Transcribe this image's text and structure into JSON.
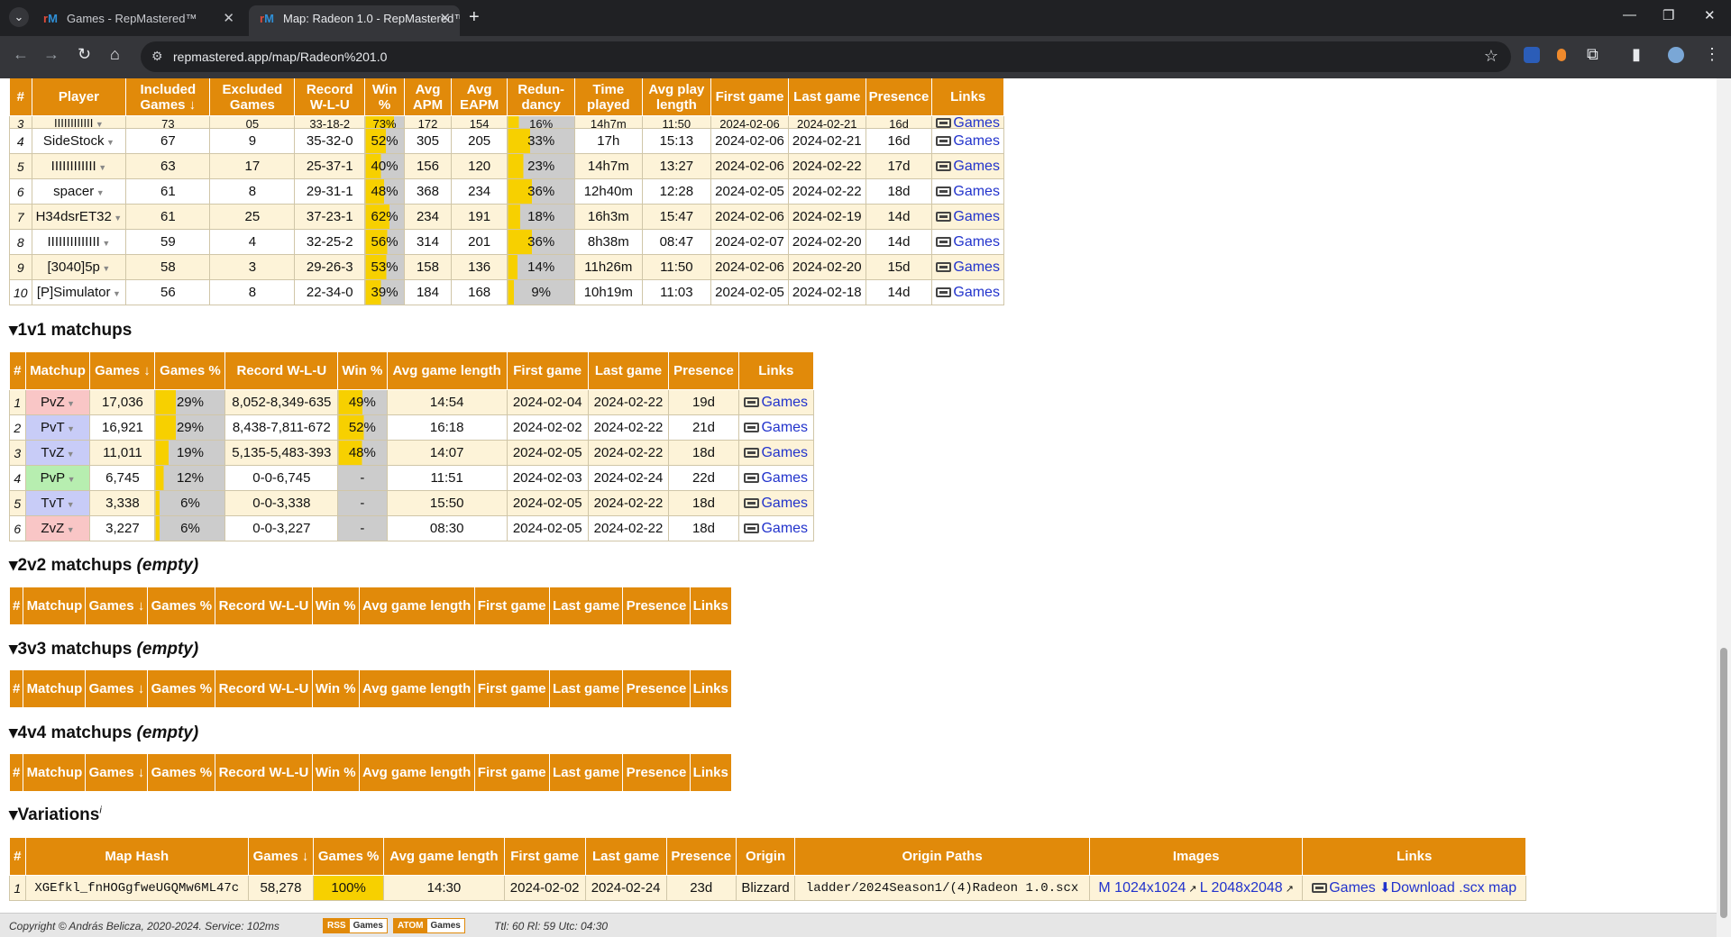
{
  "browser": {
    "tabs": [
      {
        "label": "Games - RepMastered™"
      },
      {
        "label": "Map: Radeon 1.0 - RepMastered™"
      }
    ],
    "url": "repmastered.app/map/Radeon%201.0"
  },
  "players": {
    "headers": [
      "#",
      "Player",
      "Included Games ↓",
      "Excluded Games",
      "Record W-L-U",
      "Win %",
      "Avg APM",
      "Avg EAPM",
      "Redun-dancy",
      "Time played",
      "Avg play length",
      "First game",
      "Last game",
      "Presence",
      "Links"
    ],
    "rows": [
      {
        "n": "3",
        "name": "IIIIIIIIIIII",
        "inc": "73",
        "exc": "05",
        "rec": "33-18-2",
        "win": "73%",
        "winp": 73,
        "apm": "172",
        "eapm": "154",
        "red": "16%",
        "redp": 16,
        "time": "14h7m",
        "len": "11:50",
        "first": "2024-02-06",
        "last": "2024-02-21",
        "pres": "16d",
        "link": "Games"
      },
      {
        "n": "4",
        "name": "SideStock",
        "inc": "67",
        "exc": "9",
        "rec": "35-32-0",
        "win": "52%",
        "winp": 52,
        "apm": "305",
        "eapm": "205",
        "red": "33%",
        "redp": 33,
        "time": "17h",
        "len": "15:13",
        "first": "2024-02-06",
        "last": "2024-02-21",
        "pres": "16d",
        "link": "Games"
      },
      {
        "n": "5",
        "name": "IIIIIIIIIIII",
        "inc": "63",
        "exc": "17",
        "rec": "25-37-1",
        "win": "40%",
        "winp": 40,
        "apm": "156",
        "eapm": "120",
        "red": "23%",
        "redp": 23,
        "time": "14h7m",
        "len": "13:27",
        "first": "2024-02-06",
        "last": "2024-02-22",
        "pres": "17d",
        "link": "Games"
      },
      {
        "n": "6",
        "name": "spacer",
        "inc": "61",
        "exc": "8",
        "rec": "29-31-1",
        "win": "48%",
        "winp": 48,
        "apm": "368",
        "eapm": "234",
        "red": "36%",
        "redp": 36,
        "time": "12h40m",
        "len": "12:28",
        "first": "2024-02-05",
        "last": "2024-02-22",
        "pres": "18d",
        "link": "Games"
      },
      {
        "n": "7",
        "name": "H34dsrET32",
        "inc": "61",
        "exc": "25",
        "rec": "37-23-1",
        "win": "62%",
        "winp": 62,
        "apm": "234",
        "eapm": "191",
        "red": "18%",
        "redp": 18,
        "time": "16h3m",
        "len": "15:47",
        "first": "2024-02-06",
        "last": "2024-02-19",
        "pres": "14d",
        "link": "Games"
      },
      {
        "n": "8",
        "name": "IIIIIIIIIIIIII",
        "inc": "59",
        "exc": "4",
        "rec": "32-25-2",
        "win": "56%",
        "winp": 56,
        "apm": "314",
        "eapm": "201",
        "red": "36%",
        "redp": 36,
        "time": "8h38m",
        "len": "08:47",
        "first": "2024-02-07",
        "last": "2024-02-20",
        "pres": "14d",
        "link": "Games"
      },
      {
        "n": "9",
        "name": "[3040]5p",
        "inc": "58",
        "exc": "3",
        "rec": "29-26-3",
        "win": "53%",
        "winp": 53,
        "apm": "158",
        "eapm": "136",
        "red": "14%",
        "redp": 14,
        "time": "11h26m",
        "len": "11:50",
        "first": "2024-02-06",
        "last": "2024-02-20",
        "pres": "15d",
        "link": "Games"
      },
      {
        "n": "10",
        "name": "[P]Simulator",
        "inc": "56",
        "exc": "8",
        "rec": "22-34-0",
        "win": "39%",
        "winp": 39,
        "apm": "184",
        "eapm": "168",
        "red": "9%",
        "redp": 9,
        "time": "10h19m",
        "len": "11:03",
        "first": "2024-02-05",
        "last": "2024-02-18",
        "pres": "14d",
        "link": "Games"
      }
    ]
  },
  "sections": {
    "m1v1": "▾1v1 matchups",
    "m2v2": "▾2v2 matchups",
    "m3v3": "▾3v3 matchups",
    "m4v4": "▾4v4 matchups",
    "empty": "(empty)",
    "variations": "▾Variations",
    "info": "i"
  },
  "matchups": {
    "headers": [
      "#",
      "Matchup",
      "Games ↓",
      "Games %",
      "Record W-L-U",
      "Win %",
      "Avg game length",
      "First game",
      "Last game",
      "Presence",
      "Links"
    ],
    "rows": [
      {
        "n": "1",
        "m": "PvZ",
        "cls": "pvz",
        "g": "17,036",
        "gp": "29%",
        "gpp": 29,
        "rec": "8,052-8,349-635",
        "win": "49%",
        "winp": 49,
        "len": "14:54",
        "first": "2024-02-04",
        "last": "2024-02-22",
        "pres": "19d",
        "link": "Games"
      },
      {
        "n": "2",
        "m": "PvT",
        "cls": "pvt",
        "g": "16,921",
        "gp": "29%",
        "gpp": 29,
        "rec": "8,438-7,811-672",
        "win": "52%",
        "winp": 52,
        "len": "16:18",
        "first": "2024-02-02",
        "last": "2024-02-22",
        "pres": "21d",
        "link": "Games"
      },
      {
        "n": "3",
        "m": "TvZ",
        "cls": "tvz",
        "g": "11,011",
        "gp": "19%",
        "gpp": 19,
        "rec": "5,135-5,483-393",
        "win": "48%",
        "winp": 48,
        "len": "14:07",
        "first": "2024-02-05",
        "last": "2024-02-22",
        "pres": "18d",
        "link": "Games"
      },
      {
        "n": "4",
        "m": "PvP",
        "cls": "pvp",
        "g": "6,745",
        "gp": "12%",
        "gpp": 12,
        "rec": "0-0-6,745",
        "win": "-",
        "winp": 0,
        "len": "11:51",
        "first": "2024-02-03",
        "last": "2024-02-24",
        "pres": "22d",
        "link": "Games"
      },
      {
        "n": "5",
        "m": "TvT",
        "cls": "tvt",
        "g": "3,338",
        "gp": "6%",
        "gpp": 6,
        "rec": "0-0-3,338",
        "win": "-",
        "winp": 0,
        "len": "15:50",
        "first": "2024-02-05",
        "last": "2024-02-22",
        "pres": "18d",
        "link": "Games"
      },
      {
        "n": "6",
        "m": "ZvZ",
        "cls": "zvz",
        "g": "3,227",
        "gp": "6%",
        "gpp": 6,
        "rec": "0-0-3,227",
        "win": "-",
        "winp": 0,
        "len": "08:30",
        "first": "2024-02-05",
        "last": "2024-02-22",
        "pres": "18d",
        "link": "Games"
      }
    ]
  },
  "team_headers": [
    "#",
    "Matchup",
    "Games ↓",
    "Games %",
    "Record W-L-U",
    "Win %",
    "Avg game length",
    "First game",
    "Last game",
    "Presence",
    "Links"
  ],
  "variations": {
    "headers": [
      "#",
      "Map Hash",
      "Games ↓",
      "Games %",
      "Avg game length",
      "First game",
      "Last game",
      "Presence",
      "Origin",
      "Origin Paths",
      "Images",
      "Links"
    ],
    "row": {
      "n": "1",
      "hash": "XGEfkl_fnHOGgfweUGQMw6ML47c",
      "g": "58,278",
      "gp": "100%",
      "len": "14:30",
      "first": "2024-02-02",
      "last": "2024-02-24",
      "pres": "23d",
      "origin": "Blizzard",
      "path": "ladder/2024Season1/(4)Radeon 1.0.scx",
      "img1": "M 1024x1024",
      "img2": "L 2048x2048",
      "games": "Games",
      "download": "Download .scx map"
    }
  },
  "footer": {
    "copyright": "Copyright © András Belicza, 2020-2024. Service: 102ms",
    "rss": "RSS",
    "atom": "ATOM",
    "games": "Games",
    "stats": "Ttl: 60 Rl: 59 Utc: 04:30"
  }
}
